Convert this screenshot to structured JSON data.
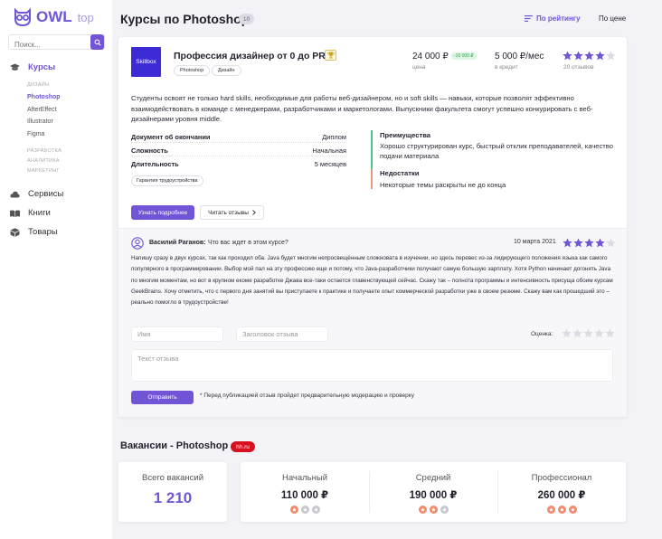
{
  "brand": {
    "name": "OWL",
    "suffix": "top"
  },
  "search": {
    "placeholder": "Поиск..."
  },
  "nav": {
    "courses": "Курсы",
    "cat_design": "ДИЗАЙН",
    "design_items": [
      "Photoshop",
      "AfterEffect",
      "Illustrator",
      "Figma"
    ],
    "cat_dev": "РАЗРАБОТКА",
    "cat_analytics": "АНАЛИТИКА",
    "cat_marketing": "МАРКЕТИНГ",
    "services": "Сервисы",
    "books": "Книги",
    "goods": "Товары"
  },
  "header": {
    "title": "Курсы по Photoshop",
    "count": "10",
    "sort_rating": "По рейтингу",
    "sort_price": "По цене"
  },
  "course": {
    "school": "Skillbox",
    "title": "Профессия дизайнер от 0 до PRO",
    "tags": [
      "Photoshop",
      "Дизайн"
    ],
    "price": "24 000 ₽",
    "discount": "-10 000 ₽",
    "price_label": "цена",
    "credit": "5 000 ₽/мес",
    "credit_label": "в кредит",
    "rating": 4,
    "reviews_count": "20 отзывов",
    "description": "Студенты освоят не только hard skills, необходимые для работы веб-дизайнером, но и soft skills — навыки, которые позволят эффективно взаимодействовать в команде с менеджерами, разработчиками и маркетологами. Выпускники факультета смогут успешно конкурировать с веб-дизайнерами уровня middle.",
    "details": [
      {
        "label": "Документ об окончании",
        "value": "Диплом"
      },
      {
        "label": "Сложность",
        "value": "Начальная"
      },
      {
        "label": "Длительность",
        "value": "5 месяцев"
      }
    ],
    "guarantee": "Гарантия трудоустройства",
    "pros_title": "Преимущества",
    "pros_text": "Хорошо структурирован курс, быстрый отклик преподавателей, качество подачи материала",
    "cons_title": "Недостатки",
    "cons_text": "Некоторые темы раскрыты не до конца",
    "more_button": "Узнать подробнее",
    "read_reviews": "Читать отзывы"
  },
  "review": {
    "author": "Василий Раганов:",
    "question": "Что вас ждет в этом курсе?",
    "date": "10 марта 2021",
    "rating": 4,
    "text": "Напишу сразу в двух курсах, так как проходил оба. Java будет многим непросвещённым сложновата в изучении, но здесь перевес из-за лидирующего положения языка как самого популярного в программировании. Выбор мой пал на эту профессию еще и потому, что Java-разработчики получают самую большую зарплату. Хотя Python начинает догонять Java по многим моментам, но вот в крупном екоме разработке Джава все-таки остается главенствующей сейчас. Скажу так – полнота программы и интенсивность присуща обоим курсам GeekBrains. Хочу отметить, что с первого дня занятий вы приступаете к практике и получаете опыт коммерческой разработки уже в своем резюме. Скажу вам как прошедший это – реально помогло в трудоустройстве!"
  },
  "form": {
    "name_placeholder": "Имя",
    "subject_placeholder": "Заголовок отзыва",
    "rating_label": "Оценка:",
    "text_placeholder": "Текст отзыва",
    "submit": "Отправить",
    "note": "* Перед публикацией отзыв пройдет предварительную модерацию и проверку"
  },
  "vacancies": {
    "title": "Вакансии - Photoshop",
    "source": "hh.ru",
    "total_label": "Всего вакансий",
    "total": "1 210",
    "levels": [
      {
        "label": "Начальный",
        "salary": "110 000 ₽",
        "level": 1
      },
      {
        "label": "Средний",
        "salary": "190 000 ₽",
        "level": 2
      },
      {
        "label": "Профессионал",
        "salary": "260 000 ₽",
        "level": 3
      }
    ]
  },
  "colors": {
    "accent": "#7155d6",
    "star": "#7155d6",
    "pros": "#4cc38a",
    "cons": "#e99a7a",
    "hh": "#d6121f",
    "salary_dot": "#f08a6a"
  }
}
